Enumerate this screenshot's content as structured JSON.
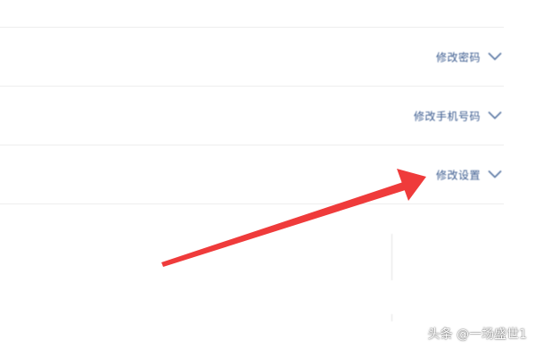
{
  "settings_rows": [
    {
      "action_label": "修改密码",
      "chevron": "chevron-down-icon"
    },
    {
      "action_label": "修改手机号码",
      "chevron": "chevron-down-icon"
    },
    {
      "action_label": "修改设置",
      "chevron": "chevron-down-icon"
    }
  ],
  "watermark": "头条 @一场盛世1",
  "colors": {
    "action_text": "#3b5b8f",
    "arrow": "#ef3b3b",
    "row_border": "#eeeeee"
  }
}
